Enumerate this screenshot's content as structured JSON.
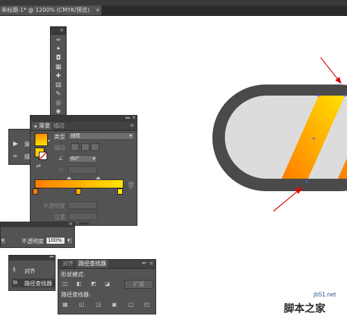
{
  "document_tab": {
    "title": "未标题-1* @ 1200% (CMYK/预览)",
    "close": "×"
  },
  "gradient_panel": {
    "tab_active": "渐变",
    "tab_inactive": "描边",
    "type_label": "类型",
    "type_value": "线性",
    "stroke_label": "描边",
    "angle_value": "60°",
    "opacity_label": "不透明度",
    "position_label": "位置",
    "ramp_colors": [
      "#ff7a00",
      "#ffe600"
    ]
  },
  "side_panel": {
    "item1": "渐",
    "item2": "描"
  },
  "shape_bar": {
    "opacity_label": "不透明度",
    "opacity_value": "100%"
  },
  "align_panel": {
    "item_align": "对齐",
    "item_pathfinder": "路径查找器"
  },
  "pathfinder_panel": {
    "tab_align": "对齐",
    "tab_pathfinder": "路径查找器",
    "shape_modes_label": "形状模式:",
    "expand_button": "扩展",
    "pathfinders_label": "路径查找器:"
  },
  "watermark": {
    "site": "jb51.net",
    "brand": "脚本之家"
  },
  "canvas": {
    "stroke_color": "#4a4a4a",
    "fill_color": "#dcdcdc",
    "arrow_color": "#e00000"
  }
}
